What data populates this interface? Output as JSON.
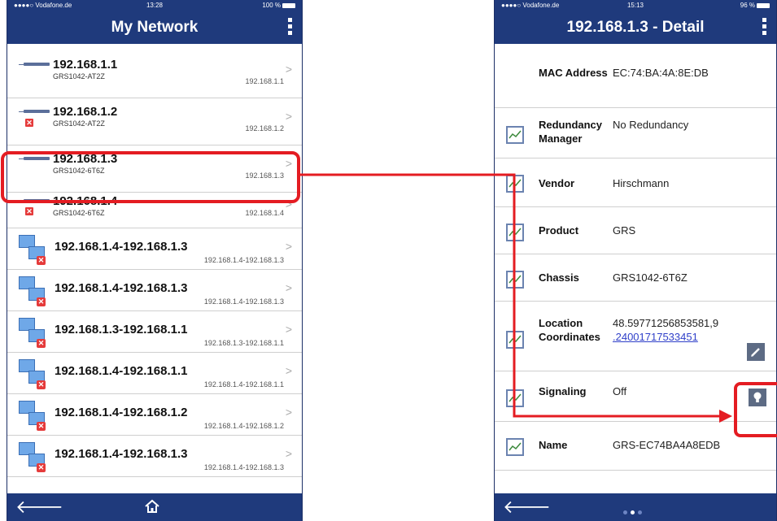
{
  "left": {
    "status": {
      "carrier": "●●●●○ Vodafone.de",
      "time": "13:28",
      "battery": "100 %"
    },
    "title": "My Network",
    "rows": [
      {
        "ip": "192.168.1.1",
        "model": "GRS1042-AT2Z",
        "right": "192.168.1.1",
        "error": false
      },
      {
        "ip": "192.168.1.2",
        "model": "GRS1042-AT2Z",
        "right": "192.168.1.2",
        "error": true
      },
      {
        "ip": "192.168.1.3",
        "model": "GRS1042-6T6Z",
        "right": "192.168.1.3",
        "error": false
      },
      {
        "ip": "192.168.1.4",
        "model": "GRS1042-6T6Z",
        "right": "192.168.1.4",
        "error": true
      }
    ],
    "links": [
      {
        "label": "192.168.1.4-192.168.1.3",
        "right": "192.168.1.4-192.168.1.3"
      },
      {
        "label": "192.168.1.4-192.168.1.3",
        "right": "192.168.1.4-192.168.1.3"
      },
      {
        "label": "192.168.1.3-192.168.1.1",
        "right": "192.168.1.3-192.168.1.1"
      },
      {
        "label": "192.168.1.4-192.168.1.1",
        "right": "192.168.1.4-192.168.1.1"
      },
      {
        "label": "192.168.1.4-192.168.1.2",
        "right": "192.168.1.4-192.168.1.2"
      },
      {
        "label": "192.168.1.4-192.168.1.3",
        "right": "192.168.1.4-192.168.1.3"
      }
    ],
    "chevron": ">"
  },
  "right": {
    "status": {
      "carrier": "●●●●○ Vodafone.de",
      "time": "15:13",
      "battery": "96 %"
    },
    "title": "192.168.1.3 - Detail",
    "rows": [
      {
        "label": "MAC Address",
        "value": "EC:74:BA:4A:8E:DB"
      },
      {
        "label": "Redundancy Manager",
        "value": "No Redundancy"
      },
      {
        "label": "Vendor",
        "value": "Hirschmann"
      },
      {
        "label": "Product",
        "value": "GRS"
      },
      {
        "label": "Chassis",
        "value": "GRS1042-6T6Z"
      },
      {
        "label": "Location Coordinates",
        "value_part1": "48.59771256853581,9",
        "value_link": ".24001717533451"
      },
      {
        "label": "Signaling",
        "value": "Off"
      },
      {
        "label": "Name",
        "value": "GRS-EC74BA4A8EDB"
      }
    ]
  },
  "colors": {
    "nav": "#1f3a7c",
    "highlight": "#e41c22",
    "error": "#e53b3b"
  }
}
